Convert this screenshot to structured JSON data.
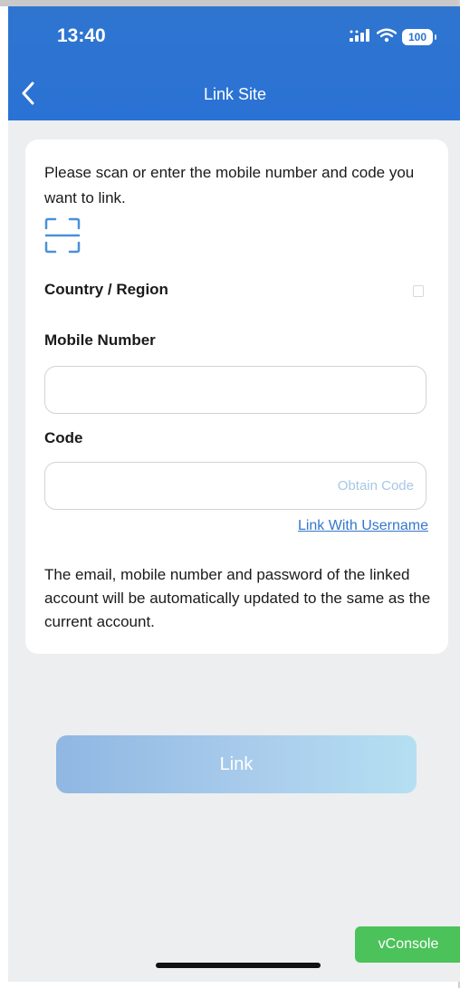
{
  "status_bar": {
    "time": "13:40",
    "battery": "100"
  },
  "header": {
    "title": "Link Site",
    "back_icon": "chevron-left-icon"
  },
  "form": {
    "intro": "Please scan or enter the mobile number and code you want to link.",
    "scan_icon": "scan-icon",
    "country_label": "Country / Region",
    "mobile_label": "Mobile Number",
    "mobile_value": "",
    "mobile_placeholder": "",
    "code_label": "Code",
    "code_value": "",
    "code_placeholder": "",
    "obtain_code": "Obtain Code",
    "link_with_username": "Link With Username",
    "note": "The email, mobile number and password of the linked account will be automatically updated to the same as the current account."
  },
  "actions": {
    "link_button": "Link"
  },
  "debug": {
    "vconsole": "vConsole"
  },
  "colors": {
    "header_blue": "#2b73d2",
    "link_blue": "#3577cc",
    "button_gradient_start": "#8fb7e2",
    "button_gradient_end": "#b5dff2",
    "vconsole_green": "#4cc25a"
  }
}
